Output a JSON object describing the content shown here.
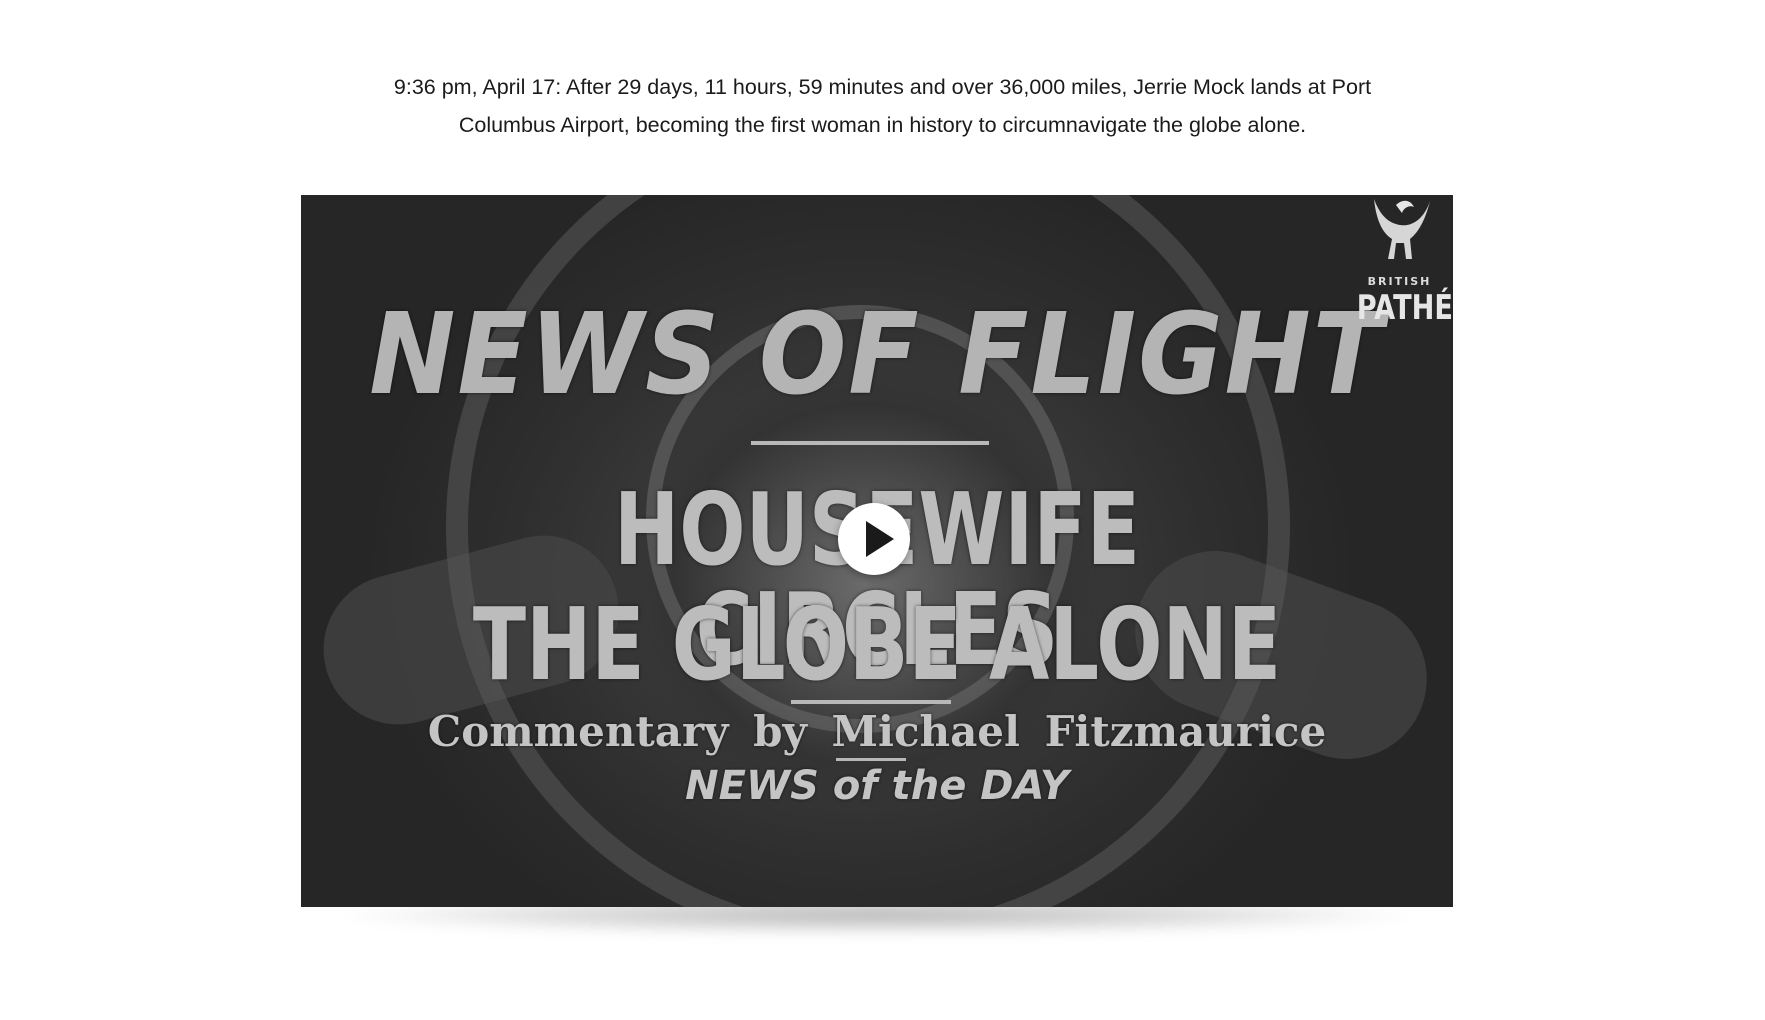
{
  "caption": {
    "line1": "9:36 pm,  April 17: After 29 days, 11 hours, 59 minutes and over 36,000 miles, Jerrie Mock lands at Port",
    "line2": "Columbus Airport, becoming the first woman in history to circumnavigate the globe alone."
  },
  "video": {
    "title_main": "NEWS OF FLIGHT",
    "title_line1": "HOUSEWIFE CIRCLES",
    "title_line2": "THE GLOBE ALONE",
    "credit": "Commentary by Michael Fitzmaurice",
    "network": "NEWS of the DAY",
    "logo": {
      "small": "BRITISH",
      "big": "PATHÉ"
    },
    "play_icon": "play-icon"
  },
  "colors": {
    "background": "#ffffff",
    "caption_text": "#1b1b1b",
    "video_bg": "#2c2c2c",
    "play_button": "#ffffff"
  }
}
